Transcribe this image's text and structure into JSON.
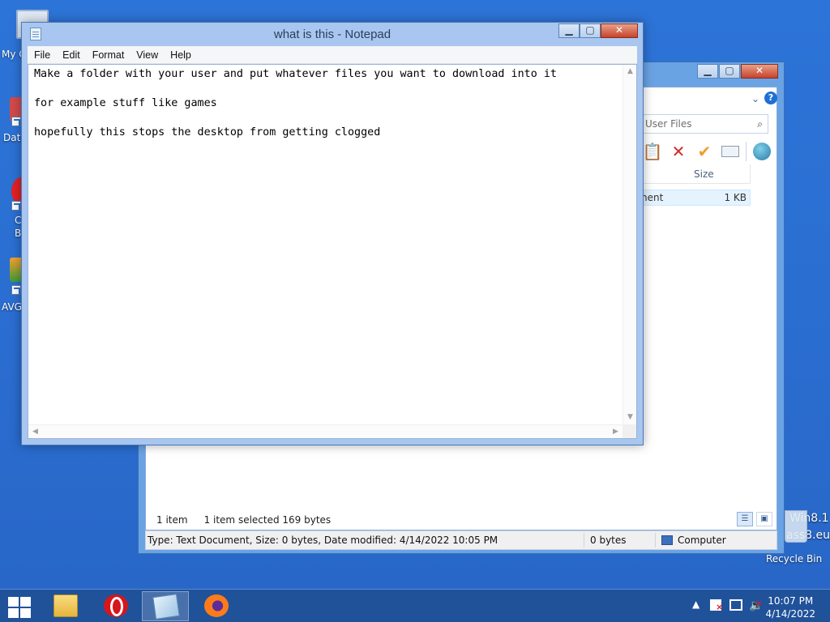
{
  "desktop": {
    "icons": {
      "computer": "My C",
      "data": "Data",
      "opera_1": "C",
      "opera_2": "B",
      "avg": "AVG",
      "recycle_bin": "Recycle Bin"
    },
    "watermark_1": "Win8.1",
    "watermark_2": "ass8.eu"
  },
  "explorer": {
    "search_placeholder": "User Files",
    "column_size": "Size",
    "file_type_fragment": "nent",
    "file_size": "1 KB",
    "status": {
      "items": "1 item",
      "selected": "1 item selected  169 bytes"
    },
    "details": {
      "info": "Type: Text Document, Size: 0 bytes, Date modified: 4/14/2022 10:05 PM",
      "size": "0 bytes",
      "location": "Computer"
    }
  },
  "notepad": {
    "title": "what is this - Notepad",
    "menu": [
      "File",
      "Edit",
      "Format",
      "View",
      "Help"
    ],
    "lines": [
      "Make a folder with your user and put whatever files you want to download into it",
      "",
      "for example stuff like games",
      "",
      "hopefully this stops the desktop from getting clogged"
    ]
  },
  "window_controls": {
    "minimize": "▁",
    "maximize": "▢",
    "close": "✕"
  },
  "taskbar": {
    "clock_time": "10:07 PM",
    "clock_date": "4/14/2022",
    "apps": [
      "file-explorer",
      "opera",
      "notepad",
      "firefox"
    ]
  },
  "colors": {
    "desktop": "#2b6fcf",
    "close_button": "#c7432a",
    "window_frame": "#a8c6ef"
  }
}
